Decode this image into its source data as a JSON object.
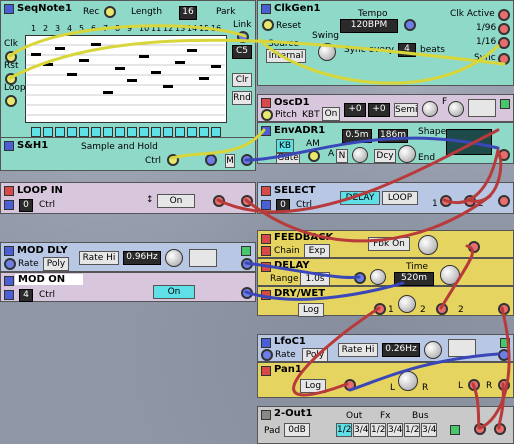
{
  "seq": {
    "title": "SeqNote1",
    "rec": "Rec",
    "length_label": "Length",
    "length_value": "16",
    "park": "Park",
    "link": "Link",
    "clk": "Clk",
    "rst": "Rst",
    "loop": "Loop",
    "note": "C5",
    "clr": "Clr",
    "rnd": "Rnd",
    "steps": [
      "1",
      "2",
      "3",
      "4",
      "5",
      "6",
      "7",
      "8",
      "9",
      "10",
      "11",
      "12",
      "13",
      "14",
      "15",
      "16"
    ]
  },
  "clkgen": {
    "title": "ClkGen1",
    "reset": "Reset",
    "tempo_label": "Tempo",
    "tempo_value": "120BPM",
    "source_label": "Source",
    "source_value": "Internal",
    "swing_label": "Swing",
    "sync_label": "Sync every",
    "sync_value": "4",
    "beats": "beats",
    "clk_active": "Clk Active",
    "d96": "1/96",
    "d16": "1/16",
    "sync": "Sync"
  },
  "osc": {
    "title": "OscD1",
    "pitch": "Pitch",
    "kbt": "KBT",
    "on": "On",
    "v1": "+0",
    "v2": "+0",
    "semi": "Semi",
    "f": "F"
  },
  "env": {
    "title": "EnvADR1",
    "kb": "KB",
    "am": "AM",
    "gate": "Gate",
    "a": "A",
    "a_value": "0.5m",
    "d_value": "186m",
    "n": "N",
    "dcy": "Dcy",
    "shape": "Shape",
    "end": "End"
  },
  "sh": {
    "title": "S&H1",
    "desc": "Sample and Hold",
    "ctrl": "Ctrl",
    "m": "M"
  },
  "loopin": {
    "title": "LOOP IN",
    "val": "0",
    "ctrl": "Ctrl",
    "on": "On"
  },
  "select": {
    "title": "SELECT",
    "val": "0",
    "ctrl": "Ctrl",
    "delay": "DELAY",
    "loop": "LOOP",
    "in1": "1",
    "in2": "2"
  },
  "moddly": {
    "title": "MOD DLY",
    "rate": "Rate",
    "poly": "Poly",
    "rate_hi": "Rate Hi",
    "freq": "0.96Hz"
  },
  "modon": {
    "title": "MOD ON",
    "val": "4",
    "ctrl": "Ctrl",
    "on": "On"
  },
  "feedback": {
    "title": "FEEDBACK",
    "chain": "Chain",
    "exp": "Exp",
    "fbk": "Fbk On"
  },
  "delay": {
    "title": "DELAY",
    "range": "Range",
    "range_value": "1.0s",
    "time": "Time",
    "time_value": "520m"
  },
  "drywet": {
    "title": "DRY/WET",
    "log": "Log",
    "in1": "1",
    "in2": "2"
  },
  "lfo": {
    "title": "LfoC1",
    "rate": "Rate",
    "poly": "Poly",
    "rate_hi": "Rate Hi",
    "freq": "0.26Hz"
  },
  "pan": {
    "title": "Pan1",
    "log": "Log",
    "l": "L",
    "r": "R",
    "out_l": "L",
    "out_r": "R"
  },
  "out": {
    "title": "2-Out1",
    "pad": "Pad",
    "pad_value": "0dB",
    "out": "Out",
    "fx": "Fx",
    "bus": "Bus",
    "b1": "1/2",
    "b2": "3/4",
    "b3": "1/2",
    "b4": "3/4",
    "b5": "1/2",
    "b6": "3/4"
  },
  "colors": {
    "cable_yellow": "#d8d63a",
    "cable_red": "#b83a3a",
    "cable_blue": "#3a47b8",
    "cable_gray": "#8a8a8a"
  }
}
